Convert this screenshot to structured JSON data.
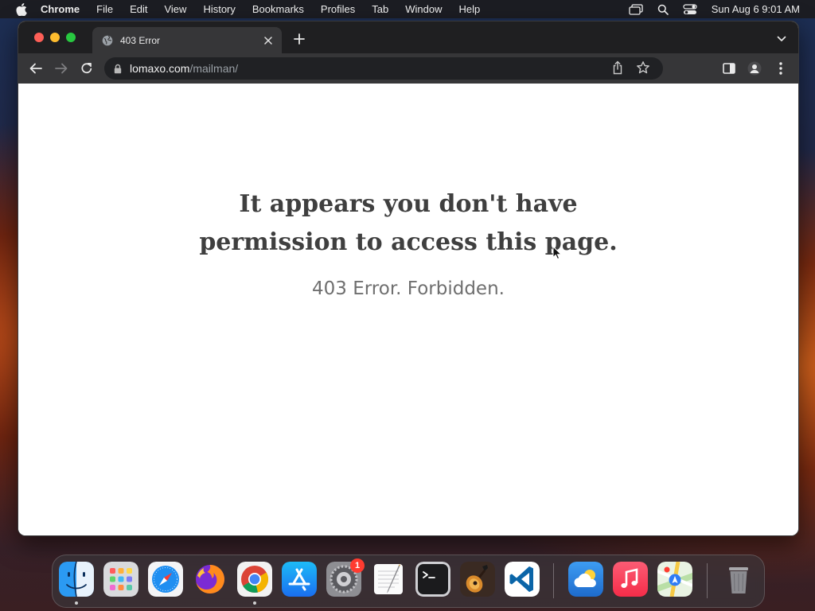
{
  "menubar": {
    "app_name": "Chrome",
    "items": [
      "File",
      "Edit",
      "View",
      "History",
      "Bookmarks",
      "Profiles",
      "Tab",
      "Window",
      "Help"
    ],
    "clock": "Sun Aug 6  9:01 AM"
  },
  "browser": {
    "tab": {
      "title": "403 Error"
    },
    "address": {
      "host": "lomaxo.com",
      "path": "/mailman/"
    }
  },
  "page": {
    "headline_line1": "It appears you don't have",
    "headline_line2": "permission to access this page.",
    "subtitle": "403 Error. Forbidden."
  },
  "dock": {
    "apps": [
      "finder",
      "launchpad",
      "safari",
      "firefox",
      "chrome",
      "app-store",
      "system-settings",
      "textedit",
      "terminal",
      "garageband",
      "vscode",
      "weather",
      "music",
      "maps",
      "trash"
    ],
    "system_settings_badge": "1"
  },
  "colors": {
    "menubar_bg": "#1c1c20",
    "tabstrip_bg": "#1f1f21",
    "toolbar_bg": "#363638",
    "headline_text": "#3f3f3f",
    "subtitle_text": "#6f6f6f"
  }
}
